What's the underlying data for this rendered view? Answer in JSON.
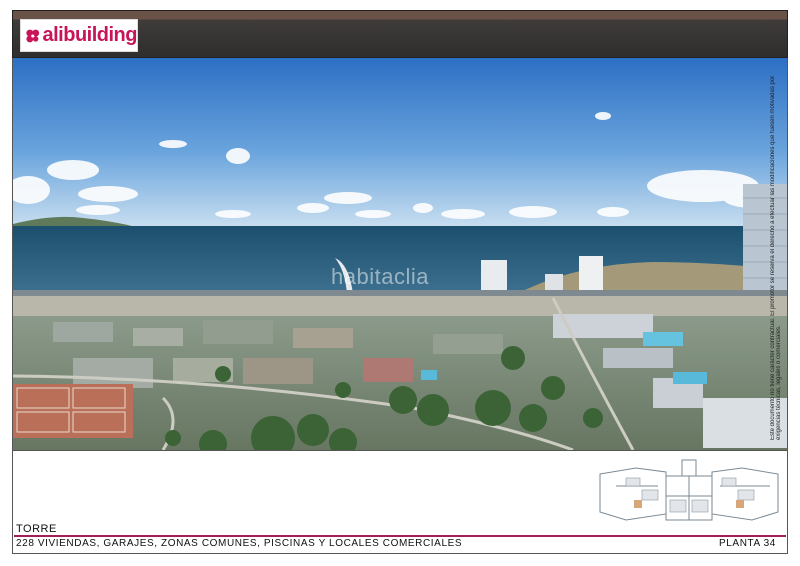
{
  "brand": {
    "name": "alibuilding",
    "color": "#c8155a"
  },
  "render": {
    "watermark": "habitaclia",
    "side_note": "Este documento no tiene carácter contractual. El promotor se reserva el derecho a efectuar las modificaciones que fuesen motivadas por exigencias técnicas, legales o comerciales."
  },
  "footer": {
    "building": "TORRE",
    "description": "228 VIVIENDAS, GARAJES, ZONAS COMUNES, PISCINAS Y LOCALES COMERCIALES",
    "floor": "PLANTA 34",
    "accent_color": "#a21e5a"
  },
  "icons": {
    "logo": "alibuilding-flower-logo",
    "plan": "floor-plan-thumbnail"
  }
}
